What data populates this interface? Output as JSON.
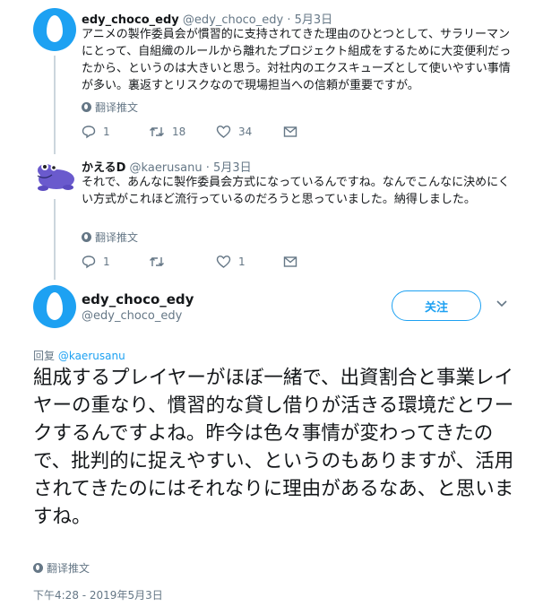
{
  "tweet1": {
    "name": "edy_choco_edy",
    "handle": "@edy_choco_edy",
    "separator": "·",
    "date": "5月3日",
    "text": "アニメの製作委員会が慣習的に支持されてきた理由のひとつとして、サラリーマンにとって、自組織のルールから離れたプロジェクト組成をするために大変便利だったから、というのは大きいと思う。対社内のエクスキューズとして使いやすい事情が多い。裏返すとリスクなので現場担当への信頼が重要ですが。",
    "translate": "翻译推文",
    "replies": "1",
    "retweets": "18",
    "likes": "34"
  },
  "tweet2": {
    "name": "かえるD",
    "handle": "@kaerusanu",
    "separator": "·",
    "date": "5月3日",
    "text": "それで、あんなに製作委員会方式になっているんですね。なんでこんなに決めにくい方式がこれほど流行っているのだろうと思っていました。納得しました。",
    "translate": "翻译推文",
    "replies": "1",
    "retweets": "",
    "likes": "1"
  },
  "main": {
    "name": "edy_choco_edy",
    "handle": "@edy_choco_edy",
    "follow_label": "关注",
    "reply_prefix": "回复",
    "reply_to": "@kaerusanu",
    "text": "組成するプレイヤーがほぼ一緒で、出資割合と事業レイヤーの重なり、慣習的な貸し借りが活きる環境だとワークするんですよね。昨今は色々事情が変わってきたので、批判的に捉えやすい、というのもありますが、活用されてきたのにはそれなりに理由があるなあ、と思いますね。",
    "translate": "翻译推文",
    "timestamp": "下午4:28 - 2019年5月3日"
  },
  "colors": {
    "accent": "#1da1f2",
    "muted": "#657786",
    "text": "#14171a",
    "frog": "#6a5acd"
  }
}
